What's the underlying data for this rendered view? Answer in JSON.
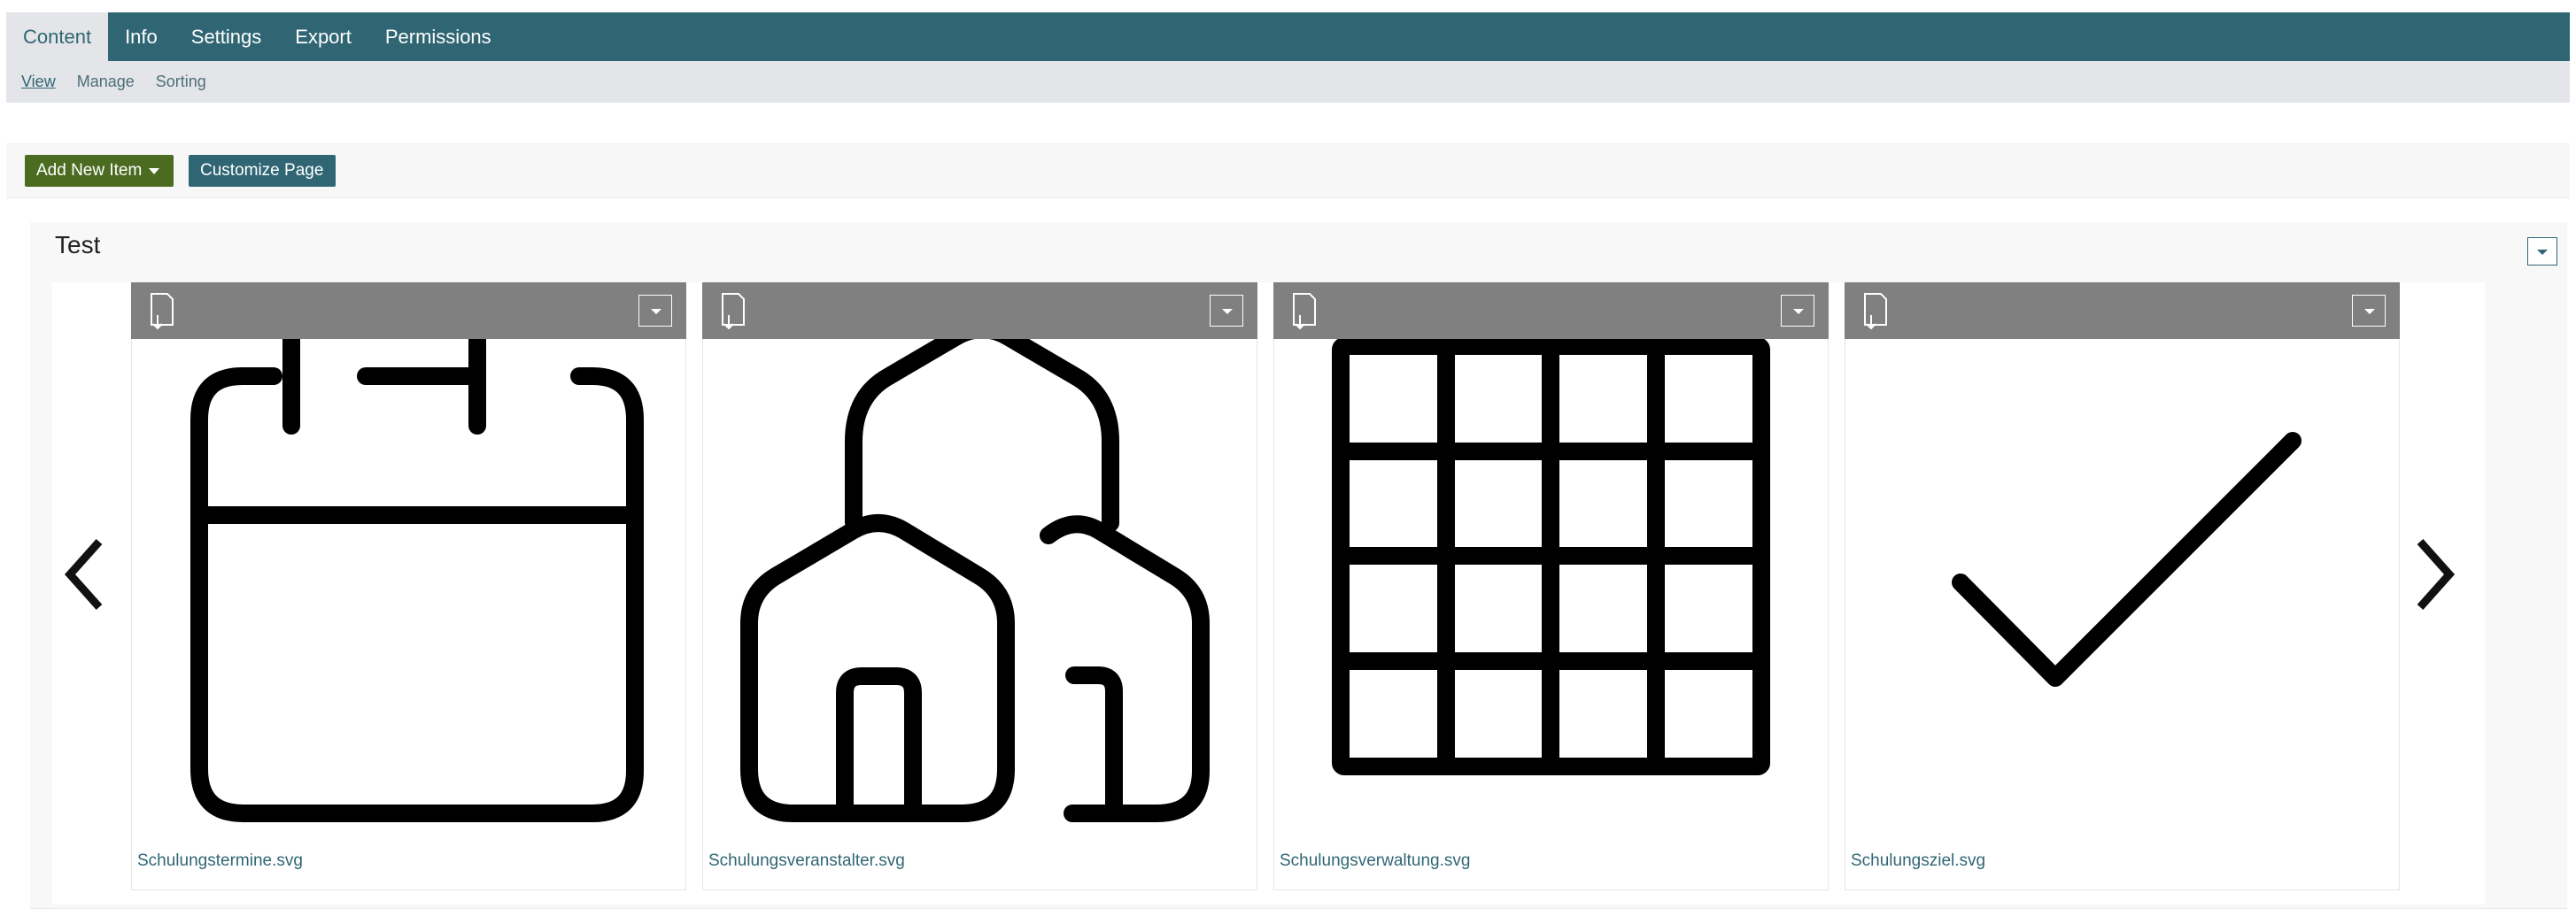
{
  "top_tabs": [
    "Content",
    "Info",
    "Settings",
    "Export",
    "Permissions"
  ],
  "sub_tabs": [
    "View",
    "Manage",
    "Sorting"
  ],
  "toolbar": {
    "add_label": "Add New Item",
    "customize_label": "Customize Page"
  },
  "panel": {
    "title": "Test",
    "items": [
      {
        "filename": "Schulungstermine.svg",
        "icon": "calendar-icon"
      },
      {
        "filename": "Schulungsveranstalter.svg",
        "icon": "houses-icon"
      },
      {
        "filename": "Schulungsverwaltung.svg",
        "icon": "grid-icon"
      },
      {
        "filename": "Schulungsziel.svg",
        "icon": "checkmark-icon"
      }
    ]
  },
  "colors": {
    "primary": "#306674",
    "success": "#4b6b21",
    "card_header": "#808080",
    "subnav_bg": "#e3e5e8"
  }
}
